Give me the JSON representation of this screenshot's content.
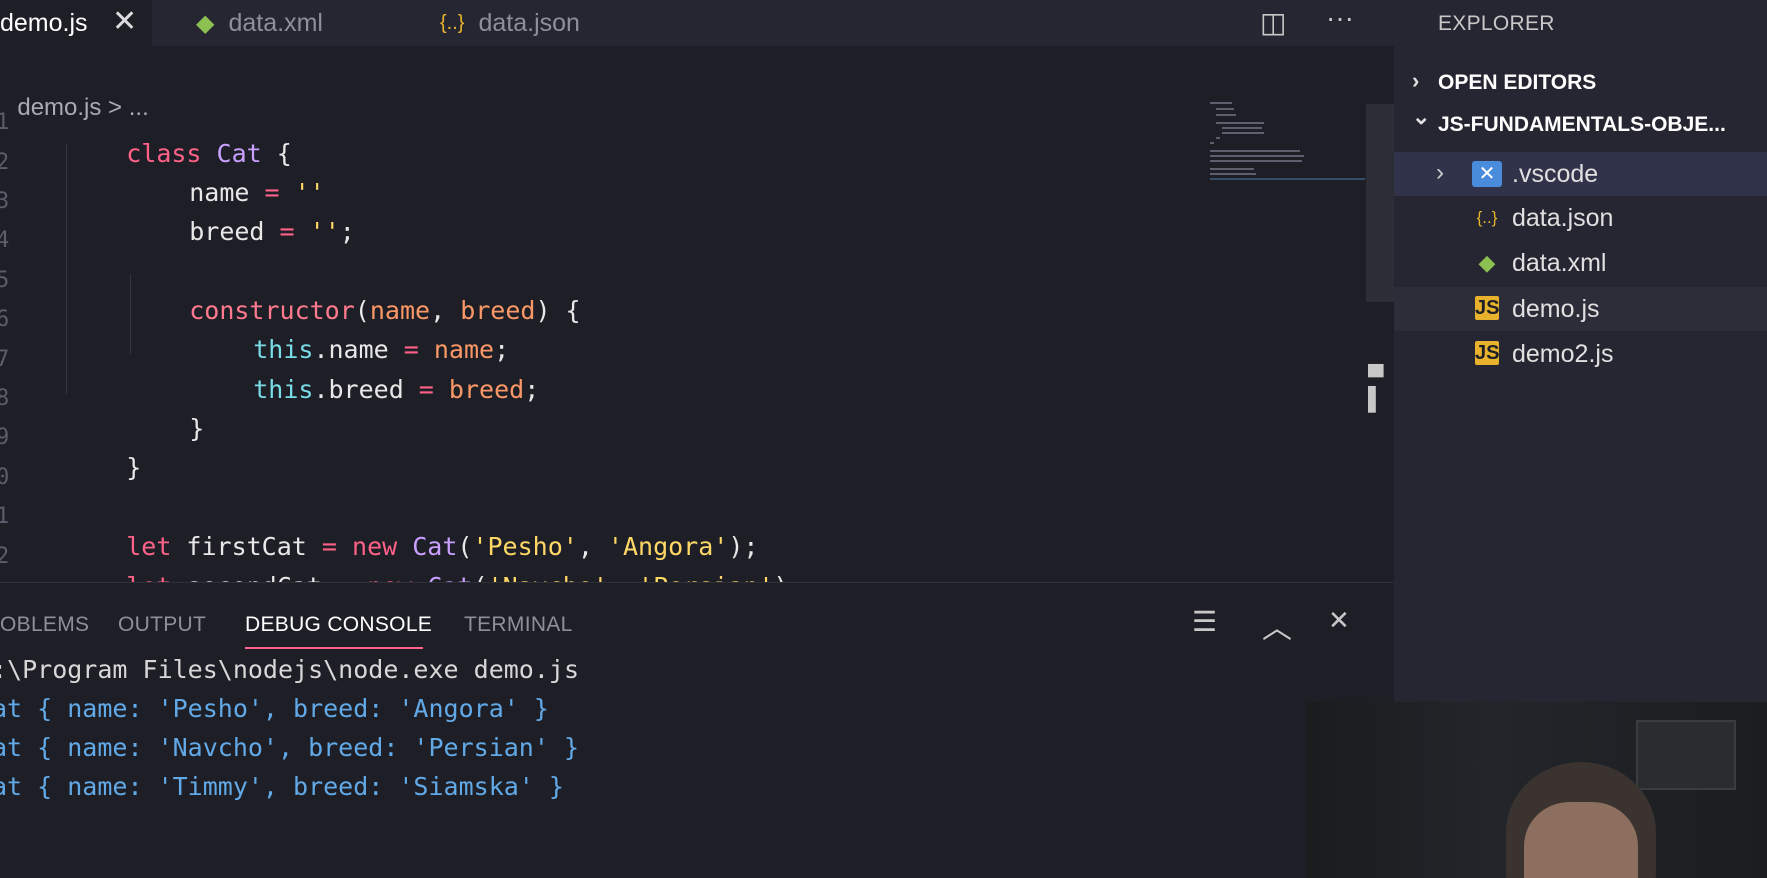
{
  "tabs": [
    {
      "label": "demo.js",
      "icon": "js-icon",
      "active": true
    },
    {
      "label": "data.xml",
      "icon": "xml-file-icon",
      "active": false
    },
    {
      "label": "data.json",
      "icon": "json-braces-icon",
      "active": false
    }
  ],
  "tab_icons": {
    "close": "✕",
    "split": "◫",
    "more": "···",
    "json": "{..}",
    "xml": "◆"
  },
  "breadcrumb": {
    "file": "demo.js",
    "sep": " > ",
    "more": "..."
  },
  "code": {
    "line_numbers": [
      "1",
      "2",
      "3",
      "4",
      "5",
      "6",
      "7",
      "8",
      "9",
      "0",
      "1",
      "2"
    ],
    "l1": [
      "class",
      " ",
      "Cat",
      " {"
    ],
    "l2": [
      "name",
      " ",
      "=",
      " ",
      "''"
    ],
    "l3": [
      "breed",
      " ",
      "=",
      " ",
      "''",
      ";"
    ],
    "l5": [
      "constructor",
      "(",
      "name",
      ", ",
      "breed",
      ") {"
    ],
    "l6": [
      "this",
      ".name ",
      "=",
      " ",
      "name",
      ";"
    ],
    "l7": [
      "this",
      ".breed ",
      "=",
      " ",
      "breed",
      ";"
    ],
    "l8": [
      "}"
    ],
    "l9": [
      "}"
    ],
    "l11": [
      "let",
      " firstCat ",
      "=",
      " ",
      "new",
      " ",
      "Cat",
      "(",
      "'Pesho'",
      ", ",
      "'Angora'",
      ");"
    ],
    "l12": [
      "let",
      " secondCat ",
      "=",
      " ",
      "new",
      " ",
      "Cat",
      "(",
      "'Navcho'",
      ", ",
      "'Persian'",
      ");"
    ]
  },
  "panel": {
    "tabs": [
      "OBLEMS",
      "OUTPUT",
      "DEBUG CONSOLE",
      "TERMINAL"
    ],
    "active_tab": "DEBUG CONSOLE",
    "icons": {
      "clear": "☰",
      "maximize": "︿",
      "close": "✕"
    },
    "console_lines": [
      ":\\Program Files\\nodejs\\node.exe demo.js",
      "at { name: 'Pesho', breed: 'Angora' }",
      "at { name: 'Navcho', breed: 'Persian' }",
      "at { name: 'Timmy', breed: 'Siamska' }"
    ]
  },
  "explorer": {
    "title": "EXPLORER",
    "open_editors": "OPEN EDITORS",
    "project": "JS-FUNDAMENTALS-OBJE...",
    "chevron_right": "›",
    "chevron_down": "⌄",
    "items": [
      {
        "name": ".vscode",
        "icon": "vscode-folder-icon",
        "glyph": "✕",
        "folder": true,
        "state": "selected"
      },
      {
        "name": "data.json",
        "icon": "json-braces-icon",
        "glyph": "{..}",
        "folder": false,
        "state": ""
      },
      {
        "name": "data.xml",
        "icon": "xml-file-icon",
        "glyph": "◆",
        "folder": false,
        "state": ""
      },
      {
        "name": "demo.js",
        "icon": "js-icon",
        "glyph": "JS",
        "folder": false,
        "state": "hover"
      },
      {
        "name": "demo2.js",
        "icon": "js-icon",
        "glyph": "JS",
        "folder": false,
        "state": ""
      }
    ]
  },
  "colors": {
    "keyword": "#ff6188",
    "class": "#c9a0ff",
    "param": "#fc9867",
    "this": "#78dce8",
    "string": "#ffd866",
    "console_text": "#62a9e8",
    "js_badge": "#e8b22c"
  }
}
